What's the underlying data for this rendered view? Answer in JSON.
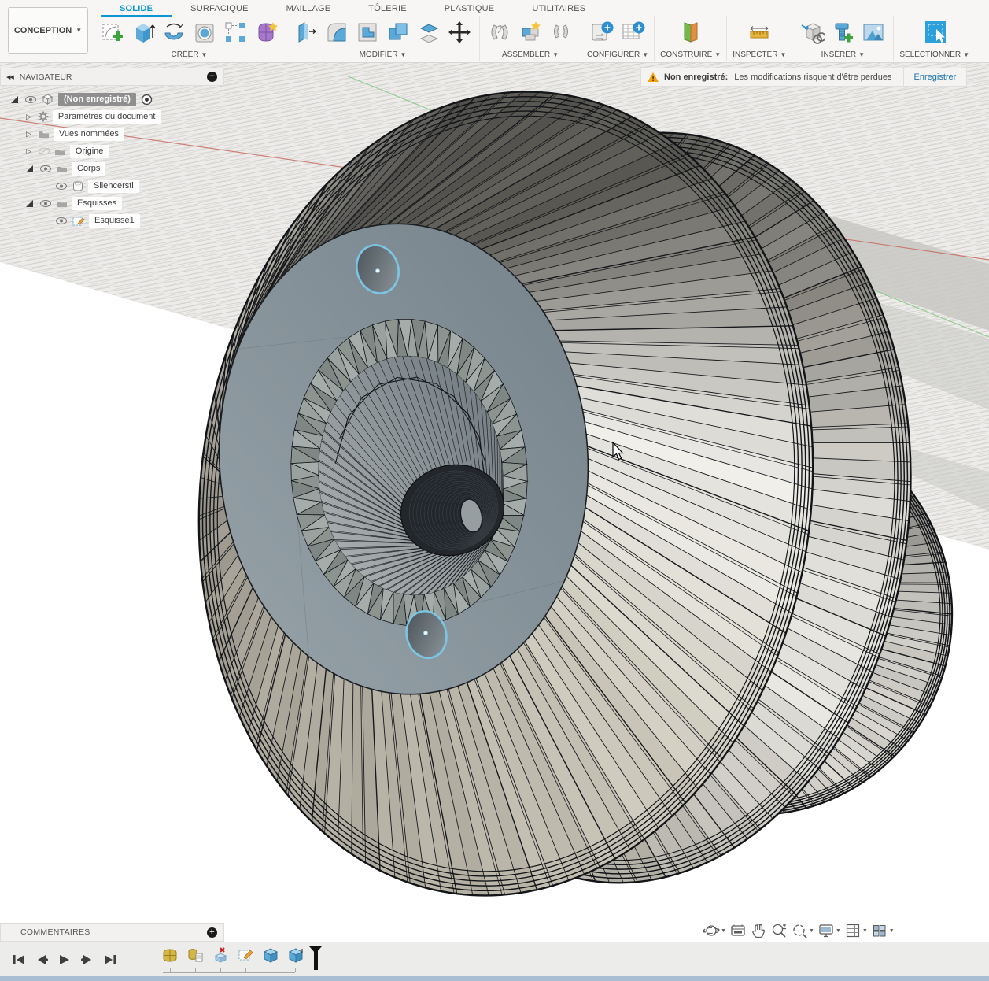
{
  "toolbar": {
    "conception": "CONCEPTION",
    "tabs": [
      {
        "label": "SOLIDE",
        "active": true
      },
      {
        "label": "SURFACIQUE"
      },
      {
        "label": "MAILLAGE"
      },
      {
        "label": "TÔLERIE"
      },
      {
        "label": "PLASTIQUE"
      },
      {
        "label": "UTILITAIRES"
      }
    ],
    "groups": {
      "create": "CRÉER",
      "modify": "MODIFIER",
      "assemble": "ASSEMBLER",
      "configure": "CONFIGURER",
      "construct": "CONSTRUIRE",
      "inspect": "INSPECTER",
      "insert": "INSÉRER",
      "select": "SÉLECTIONNER"
    }
  },
  "warning": {
    "title": "Non enregistré:",
    "message": "Les modifications risquent d'être perdues",
    "action": "Enregistrer"
  },
  "navigator": {
    "title": "NAVIGATEUR",
    "items": [
      {
        "label": "(Non enregistré)"
      },
      {
        "label": "Paramètres du document"
      },
      {
        "label": "Vues nommées"
      },
      {
        "label": "Origine"
      },
      {
        "label": "Corps"
      },
      {
        "label": "Silencerstl"
      },
      {
        "label": "Esquisses"
      },
      {
        "label": "Esquisse1"
      }
    ]
  },
  "comments": {
    "title": "COMMENTAIRES"
  },
  "timeline": {
    "features": [
      "form",
      "mesh",
      "delete-face",
      "sketch",
      "extrude",
      "extrude"
    ]
  },
  "view_toolbar": [
    "orbit",
    "look-at",
    "pan",
    "zoom",
    "fit",
    "display-settings",
    "grid",
    "viewports"
  ],
  "colors": {
    "accent_blue": "#0a96d3",
    "selection_blue": "#7cc9ea",
    "axis_red": "#c96b62",
    "axis_green": "#86c786",
    "plane_fill": "#edecea",
    "plane_line": "#c9c7c2",
    "plane_shadow": "#c6c5c2",
    "edge_dark": "#121417",
    "mesh_line": "#17191c",
    "flange_light": "#97a3a9",
    "flange_dark": "#76828a",
    "cone_light": "#b0b6b6",
    "cone_dark": "#6c777d",
    "cyl_dark": "#23272c",
    "body1_stops": [
      [
        -180,
        "#9a968c"
      ],
      [
        -135,
        "#bab7ae"
      ],
      [
        -95,
        "#555450"
      ],
      [
        -60,
        "#605e58"
      ],
      [
        -25,
        "#bebdb7"
      ],
      [
        0,
        "#ecebe7"
      ],
      [
        25,
        "#e4e2da"
      ],
      [
        60,
        "#cdc9bc"
      ],
      [
        95,
        "#b6b2a5"
      ],
      [
        135,
        "#aba79b"
      ],
      [
        180,
        "#9a968c"
      ]
    ],
    "body2_stops": [
      [
        -180,
        "#e8e7e2"
      ],
      [
        -120,
        "#8a8881"
      ],
      [
        -90,
        "#5b5954"
      ],
      [
        -45,
        "#8f8d86"
      ],
      [
        0,
        "#dad8d2"
      ],
      [
        45,
        "#e5e4de"
      ],
      [
        90,
        "#b3b0a6"
      ],
      [
        135,
        "#d0cdc5"
      ],
      [
        180,
        "#e8e7e2"
      ]
    ],
    "body3_stops": [
      [
        -180,
        "#dddcd6"
      ],
      [
        -90,
        "#504f4b"
      ],
      [
        -45,
        "#7b7973"
      ],
      [
        0,
        "#c8c6c0"
      ],
      [
        60,
        "#d8d6cf"
      ],
      [
        120,
        "#b5b2a8"
      ],
      [
        180,
        "#dddcd6"
      ]
    ]
  }
}
